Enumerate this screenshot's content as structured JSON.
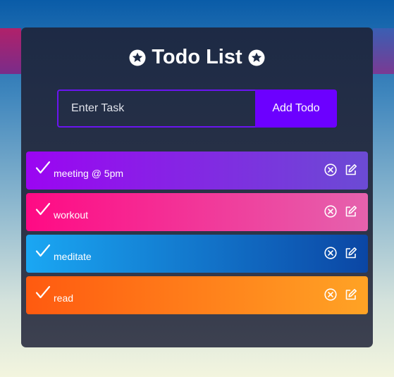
{
  "app": {
    "title": "Todo List",
    "title_icon": "star-circle-icon"
  },
  "form": {
    "placeholder": "Enter Task",
    "value": "",
    "add_label": "Add Todo"
  },
  "todos": [
    {
      "text": "meeting @ 5pm",
      "color_start": "#9b05f2",
      "color_end": "#6b4bd4"
    },
    {
      "text": "workout",
      "color_start": "#ff0a84",
      "color_end": "#e562ad"
    },
    {
      "text": "meditate",
      "color_start": "#1aa7f3",
      "color_end": "#0b46a4"
    },
    {
      "text": "read",
      "color_start": "#ff5a10",
      "color_end": "#ffa325"
    }
  ],
  "icons": {
    "check": "check-icon",
    "delete": "close-circle-icon",
    "edit": "edit-icon"
  },
  "colors": {
    "card": "#1d2a45",
    "accent": "#6c00ff",
    "input_border": "#6a15f0"
  }
}
